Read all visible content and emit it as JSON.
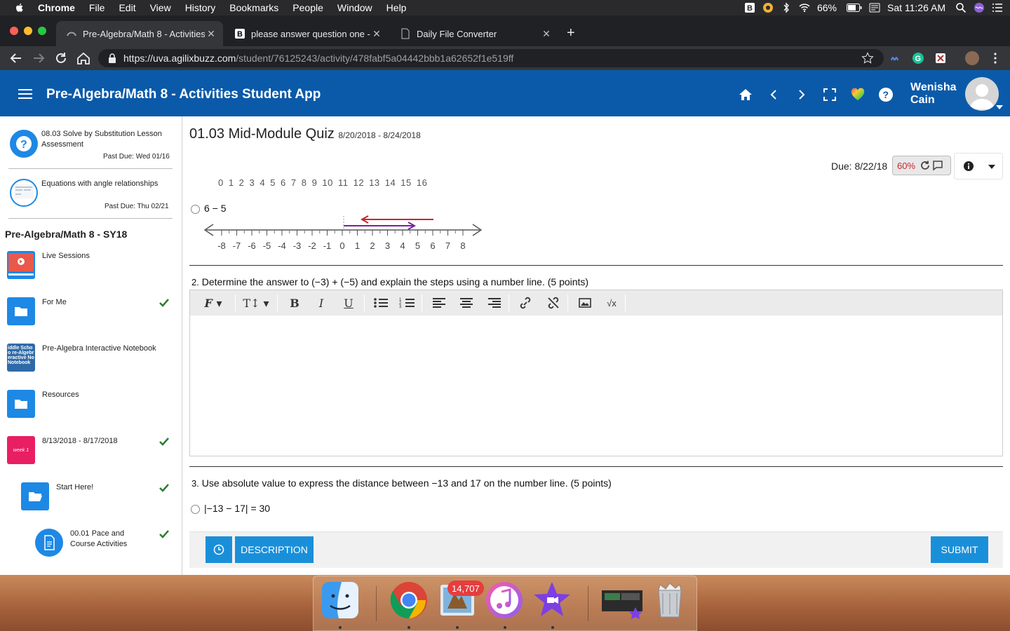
{
  "menubar": {
    "app": "Chrome",
    "items": [
      "File",
      "Edit",
      "View",
      "History",
      "Bookmarks",
      "People",
      "Window",
      "Help"
    ],
    "battery": "66%",
    "clock": "Sat 11:26 AM"
  },
  "tabs": [
    {
      "title": "Pre-Algebra/Math 8 - Activities"
    },
    {
      "title": "please answer question one - B"
    },
    {
      "title": "Daily File Converter"
    }
  ],
  "address": {
    "host": "https://uva.agilixbuzz.com",
    "path": "/student/76125243/activity/478fabf5a04442bbb1a62652f1e519ff"
  },
  "app": {
    "title": "Pre-Algebra/Math 8 - Activities Student App",
    "user_first": "Wenisha",
    "user_last": "Cain"
  },
  "sidebar": {
    "recent": [
      {
        "title": "08.03 Solve by Substitution Lesson Assessment",
        "due": "Past Due: Wed 01/16"
      },
      {
        "title": "Equations with angle relationships",
        "due": "Past Due: Thu 02/21"
      }
    ],
    "course_title": "Pre-Algebra/Math 8 - SY18",
    "items": [
      {
        "label": "Live Sessions"
      },
      {
        "label": "For Me"
      },
      {
        "label": "Pre-Algebra Interactive Notebook"
      },
      {
        "label": "Resources"
      },
      {
        "label": "8/13/2018 - 8/17/2018"
      },
      {
        "label": "Start Here!"
      },
      {
        "label": "00.01 Pace and Course Activities"
      }
    ],
    "notebook_thumb": "iddle Schoo re-Algebr eractive No Notebook",
    "week_thumb": "week 1"
  },
  "quiz": {
    "title": "01.03 Mid-Module Quiz",
    "dates": "8/20/2018 - 8/24/2018",
    "due": "Due: 8/22/18",
    "score": "60%",
    "top_numbers": "0 1 2 3 4 5 6 7 8 9 10 11 12 13 14 15 16",
    "q1_option": "6 − 5",
    "numberline_labels": [
      "-8",
      "-7",
      "-6",
      "-5",
      "-4",
      "-3",
      "-2",
      "-1",
      "0",
      "1",
      "2",
      "3",
      "4",
      "5",
      "6",
      "7",
      "8"
    ],
    "q2_number": "2.",
    "q2_text": "Determine the answer to (−3) + (−5) and explain the steps using a number line. (5 points)",
    "q3_number": "3.",
    "q3_text": "Use absolute value to express the distance between −13 and 17 on the number line. (5 points)",
    "q3_option": "|−13 − 17| = 30"
  },
  "footer": {
    "description_label": "DESCRIPTION",
    "submit_label": "SUBMIT"
  },
  "dock": {
    "mail_badge": "14,707"
  },
  "colors": {
    "app_blue": "#0b5aa9",
    "button_blue": "#1a8fd9",
    "check_green": "#2e7d32",
    "score_red": "#c62828"
  }
}
